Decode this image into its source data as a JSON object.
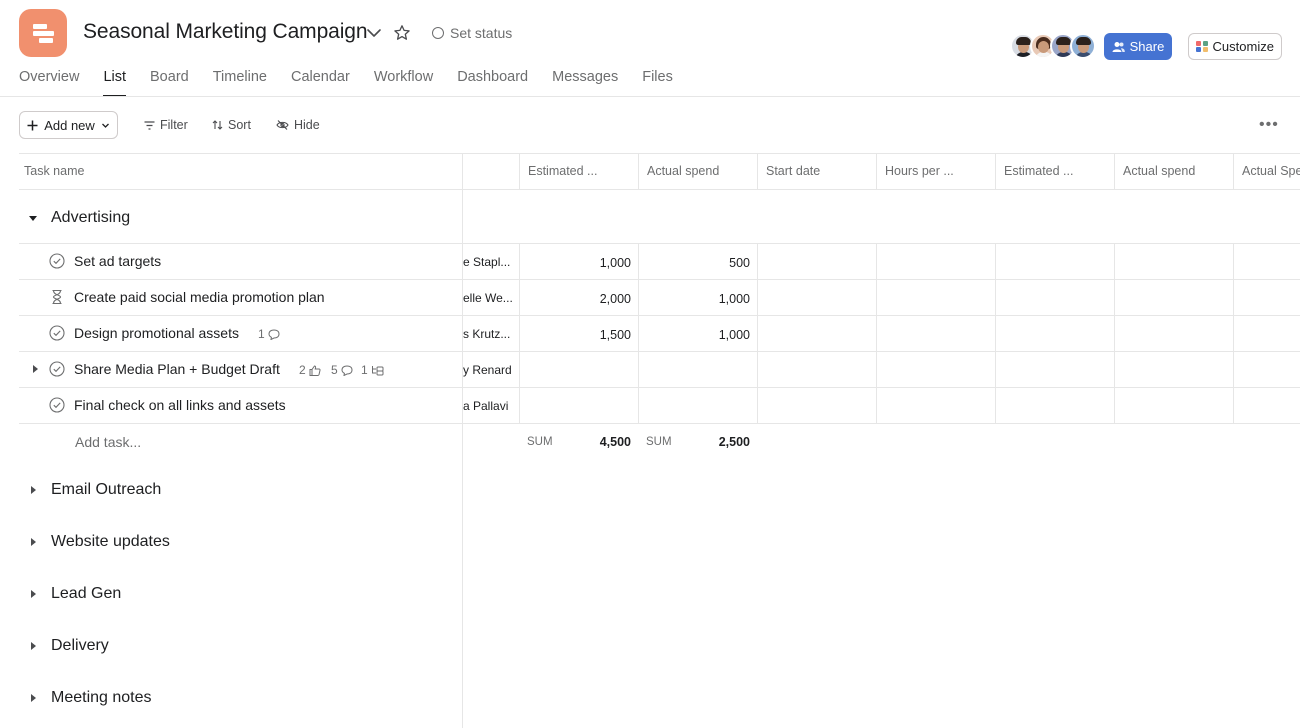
{
  "project": {
    "title": "Seasonal Marketing Campaign",
    "set_status": "Set status",
    "icon_color": "#f1906e"
  },
  "header_buttons": {
    "share": "Share",
    "customize": "Customize",
    "share_color": "#4573d2"
  },
  "tabs": [
    "Overview",
    "List",
    "Board",
    "Timeline",
    "Calendar",
    "Workflow",
    "Dashboard",
    "Messages",
    "Files"
  ],
  "active_tab": "List",
  "toolbar": {
    "add_new": "Add new",
    "filter": "Filter",
    "sort": "Sort",
    "hide": "Hide"
  },
  "columns": [
    "Task name",
    "Estimated ...",
    "Actual spend",
    "Start date",
    "Hours per ...",
    "Estimated ...",
    "Actual spend",
    "Actual Spe"
  ],
  "sections": [
    {
      "name": "Advertising",
      "expanded": true,
      "tasks": [
        {
          "name": "Set ad targets",
          "icon": "check-circle-icon",
          "assignee": "e Stapl...",
          "estimated": "1,000",
          "actual": "500"
        },
        {
          "name": "Create paid social media promotion plan",
          "icon": "hourglass-icon",
          "assignee": "elle We...",
          "estimated": "2,000",
          "actual": "1,000"
        },
        {
          "name": "Design promotional assets",
          "icon": "check-circle-icon",
          "assignee": "s Krutz...",
          "estimated": "1,500",
          "actual": "1,000",
          "comments": "1"
        },
        {
          "name": "Share Media Plan + Budget Draft",
          "icon": "check-circle-icon",
          "assignee": "y Renard",
          "estimated": "",
          "actual": "",
          "likes": "2",
          "comments": "5",
          "subtasks": "1",
          "has_subtasks": true
        },
        {
          "name": "Final check on all links and assets",
          "icon": "check-circle-icon",
          "assignee": "a Pallavi",
          "estimated": "",
          "actual": ""
        }
      ],
      "add_task": "Add task...",
      "sum_label": "SUM",
      "sum_estimated": "4,500",
      "sum_actual": "2,500"
    },
    {
      "name": "Email Outreach",
      "expanded": false
    },
    {
      "name": "Website updates",
      "expanded": false
    },
    {
      "name": "Lead Gen",
      "expanded": false
    },
    {
      "name": "Delivery",
      "expanded": false
    },
    {
      "name": "Meeting notes",
      "expanded": false
    }
  ]
}
